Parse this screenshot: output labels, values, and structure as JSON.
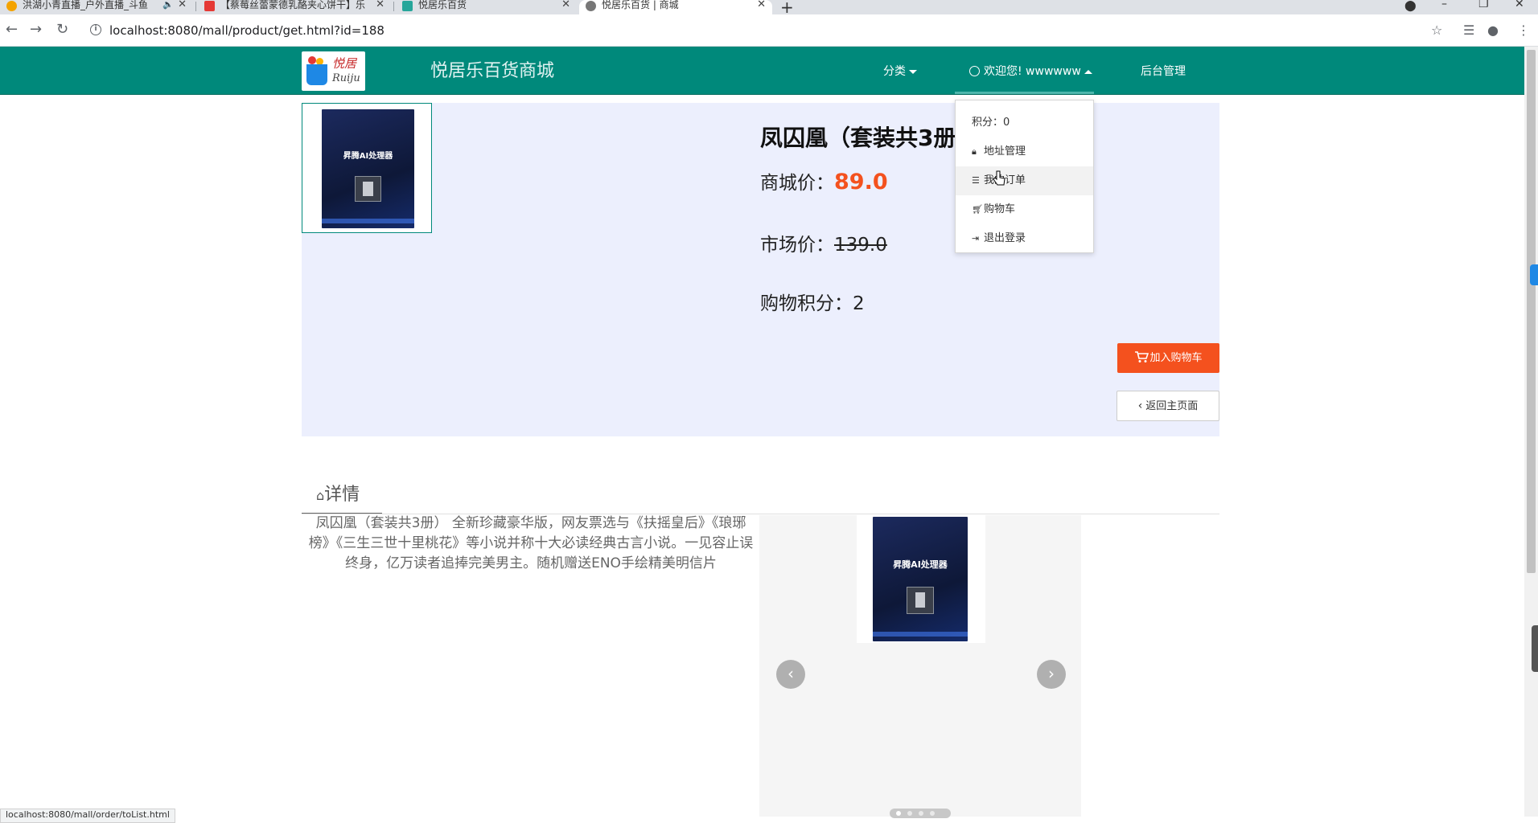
{
  "browser": {
    "tabs": [
      {
        "title": "洪湖小青直播_户外直播_斗鱼",
        "fav_color": "#f4a300"
      },
      {
        "title": "【蔡莓丝蕾蒙德乳酪夹心饼干】乐",
        "fav_color": "#e53935"
      },
      {
        "title": "悦居乐百货",
        "fav_color": "#26a69a"
      },
      {
        "title": "悦居乐百货 | 商城",
        "fav_color": "#777777"
      }
    ],
    "url": "localhost:8080/mall/product/get.html?id=188",
    "status_link": "localhost:8080/mall/order/toList.html"
  },
  "header": {
    "logo": {
      "cn": "悦居",
      "en": "Ruiju"
    },
    "site_title": "悦居乐百货商城",
    "nav": {
      "category": "分类",
      "welcome": "欢迎您! wwwwww",
      "admin": "后台管理"
    },
    "accent_color": "#00897b"
  },
  "dropdown": {
    "points": "积分：0",
    "items": [
      {
        "label": "地址管理",
        "icon": "lock-icon"
      },
      {
        "label": "我的订单",
        "icon": "list-icon"
      },
      {
        "label": "购物车",
        "icon": "cart-icon"
      },
      {
        "label": "退出登录",
        "icon": "signout-icon"
      }
    ]
  },
  "product": {
    "name": "凤囚凰（套装共3册",
    "mall_price_label": "商城价：",
    "mall_price": "89.0",
    "market_price_label": "市场价：",
    "market_price": "139.0",
    "points_label": "购物积分：",
    "points": "2",
    "add_to_cart": "加入购物车",
    "back_home": "返回主页面",
    "book_cover_title": "昇腾AI处理器"
  },
  "details": {
    "tab_label": "详情",
    "description": "凤囚凰（套装共3册） 全新珍藏豪华版，网友票选与《扶摇皇后》《琅琊榜》《三生三世十里桃花》等小说并称十大必读经典古言小说。一见容止误终身，亿万读者追捧完美男主。随机赠送ENO手绘精美明信片"
  }
}
